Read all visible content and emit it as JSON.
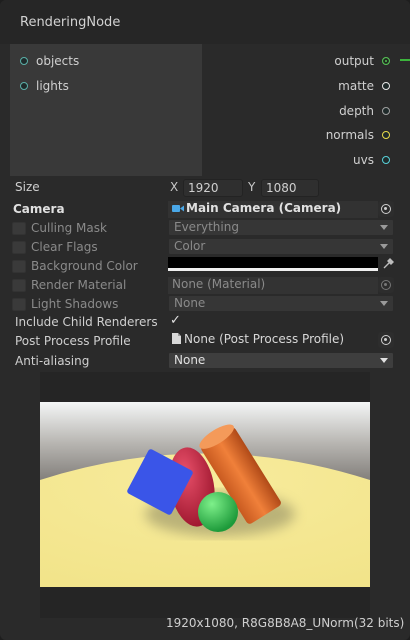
{
  "node": {
    "title": "RenderingNode",
    "inputs": [
      {
        "label": "objects"
      },
      {
        "label": "lights"
      }
    ],
    "outputs": [
      {
        "label": "output",
        "color": "#56c256"
      },
      {
        "label": "matte",
        "color": "#e6e6e6"
      },
      {
        "label": "depth",
        "color": "#a0a0a0"
      },
      {
        "label": "normals",
        "color": "#e8dc4a"
      },
      {
        "label": "uvs",
        "color": "#58d0d8"
      }
    ]
  },
  "settings": {
    "size_label": "Size",
    "x_label": "X",
    "x_value": "1920",
    "y_label": "Y",
    "y_value": "1080",
    "camera_label": "Camera",
    "camera_value": "Main Camera (Camera)",
    "culling_mask_label": "Culling Mask",
    "culling_mask_value": "Everything",
    "clear_flags_label": "Clear Flags",
    "clear_flags_value": "Color",
    "background_color_label": "Background Color",
    "background_color_value": "#000000",
    "render_material_label": "Render Material",
    "render_material_value": "None (Material)",
    "light_shadows_label": "Light Shadows",
    "light_shadows_value": "None",
    "include_child_label": "Include Child Renderers",
    "include_child_checked": "✓",
    "post_process_label": "Post Process Profile",
    "post_process_value": "None (Post Process Profile)",
    "anti_aliasing_label": "Anti-aliasing",
    "anti_aliasing_value": "None"
  },
  "preview": {
    "info": "1920x1080, R8G8B8A8_UNorm(32 bits)"
  },
  "icons": {
    "camera": "camera-icon",
    "object_picker": "object-picker-icon",
    "eyedropper": "eyedropper-icon",
    "document": "document-icon",
    "dropdown": "chevron-down-icon"
  }
}
